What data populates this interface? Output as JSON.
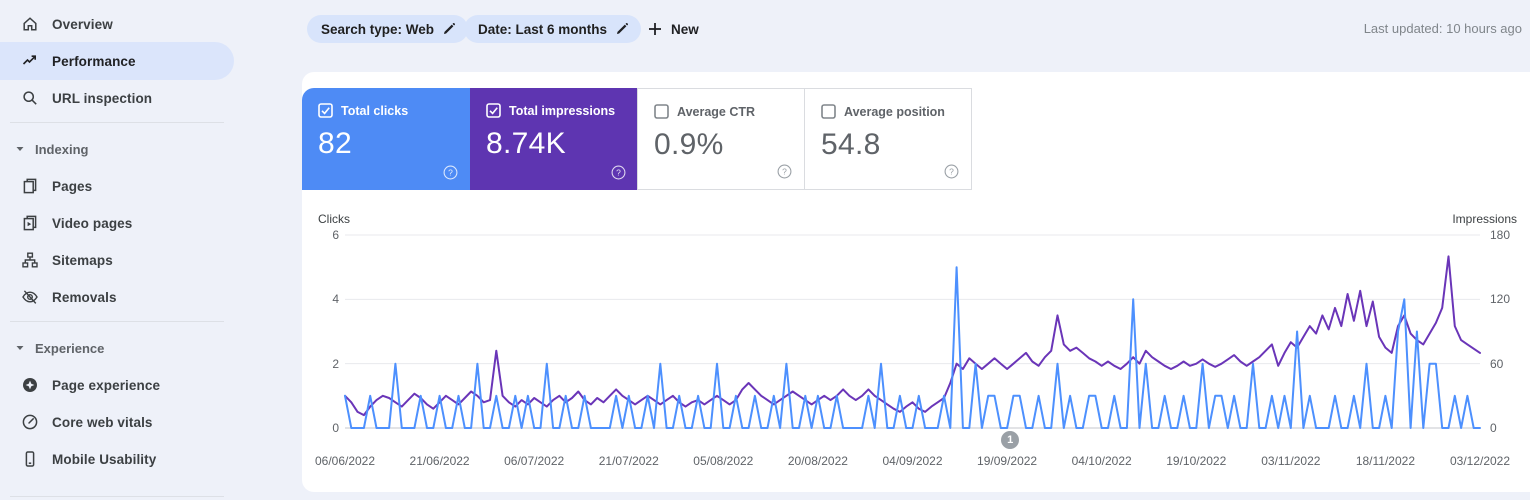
{
  "sidebar": {
    "items": [
      {
        "label": "Overview",
        "icon": "home-icon"
      },
      {
        "label": "Performance",
        "icon": "trending-up-icon",
        "selected": true
      },
      {
        "label": "URL inspection",
        "icon": "search-icon"
      }
    ],
    "sections": [
      {
        "label": "Indexing",
        "items": [
          {
            "label": "Pages",
            "icon": "pages-icon"
          },
          {
            "label": "Video pages",
            "icon": "video-pages-icon"
          },
          {
            "label": "Sitemaps",
            "icon": "sitemap-icon"
          },
          {
            "label": "Removals",
            "icon": "eye-off-icon"
          }
        ]
      },
      {
        "label": "Experience",
        "items": [
          {
            "label": "Page experience",
            "icon": "page-experience-icon"
          },
          {
            "label": "Core web vitals",
            "icon": "speedometer-icon"
          },
          {
            "label": "Mobile Usability",
            "icon": "mobile-icon"
          }
        ]
      }
    ]
  },
  "topbar": {
    "search_type_chip": "Search type: Web",
    "date_chip": "Date: Last 6 months",
    "new_label": "New",
    "last_updated": "Last updated: 10 hours ago"
  },
  "cards": [
    {
      "label": "Total clicks",
      "value": "82",
      "checked": true,
      "color": "#4e8bf5"
    },
    {
      "label": "Total impressions",
      "value": "8.74K",
      "checked": true,
      "color": "#5e35b1"
    },
    {
      "label": "Average CTR",
      "value": "0.9%",
      "checked": false
    },
    {
      "label": "Average position",
      "value": "54.8",
      "checked": false
    }
  ],
  "chart_data": {
    "type": "line",
    "x_start": "06/06/2022",
    "x_end": "03/12/2022",
    "x_tick_labels": [
      "06/06/2022",
      "21/06/2022",
      "06/07/2022",
      "21/07/2022",
      "05/08/2022",
      "20/08/2022",
      "04/09/2022",
      "19/09/2022",
      "04/10/2022",
      "19/10/2022",
      "03/11/2022",
      "18/11/2022",
      "03/12/2022"
    ],
    "y_left": {
      "label": "Clicks",
      "ticks": [
        6,
        4,
        2,
        0
      ],
      "max": 6
    },
    "y_right": {
      "label": "Impressions",
      "ticks": [
        180,
        120,
        60,
        0
      ],
      "max": 180
    },
    "grid": true,
    "legend_position": "none",
    "annotation": {
      "label": "1",
      "day_index": 105.5
    },
    "series": [
      {
        "name": "Total clicks",
        "axis": "left",
        "color": "#4d90fe",
        "values": [
          1,
          0,
          0,
          0,
          1,
          0,
          0,
          0,
          2,
          0,
          0,
          0,
          1,
          0,
          0,
          1,
          0,
          0,
          1,
          0,
          0,
          2,
          0,
          0,
          1,
          0,
          0,
          1,
          0,
          1,
          0,
          0,
          2,
          0,
          0,
          1,
          0,
          0,
          1,
          0,
          0,
          0,
          0,
          1,
          0,
          1,
          0,
          0,
          1,
          0,
          2,
          0,
          0,
          1,
          0,
          0,
          1,
          0,
          0,
          2,
          0,
          0,
          1,
          0,
          0,
          1,
          0,
          0,
          1,
          0,
          2,
          0,
          0,
          1,
          0,
          1,
          0,
          0,
          1,
          0,
          0,
          0,
          0,
          1,
          0,
          2,
          0,
          0,
          1,
          0,
          0,
          1,
          0,
          0,
          0,
          1,
          0,
          5,
          0,
          0,
          2,
          0,
          1,
          1,
          0,
          0,
          1,
          1,
          0,
          0,
          1,
          0,
          0,
          2,
          0,
          1,
          0,
          0,
          1,
          1,
          0,
          0,
          1,
          0,
          0,
          4,
          0,
          2,
          0,
          0,
          1,
          0,
          0,
          1,
          0,
          0,
          2,
          0,
          1,
          1,
          0,
          1,
          0,
          0,
          2,
          0,
          0,
          1,
          0,
          1,
          0,
          3,
          0,
          1,
          0,
          0,
          0,
          1,
          0,
          0,
          1,
          0,
          2,
          0,
          0,
          1,
          0,
          3,
          4,
          0,
          3,
          0,
          2,
          2,
          0,
          0,
          1,
          0,
          1,
          0,
          0
        ]
      },
      {
        "name": "Total impressions",
        "axis": "right",
        "color": "#6a35b8",
        "values": [
          30,
          24,
          15,
          12,
          20,
          26,
          30,
          28,
          24,
          20,
          26,
          32,
          28,
          22,
          18,
          24,
          30,
          26,
          22,
          28,
          34,
          30,
          24,
          26,
          72,
          30,
          24,
          20,
          26,
          22,
          28,
          24,
          20,
          26,
          30,
          24,
          28,
          34,
          26,
          22,
          28,
          24,
          30,
          36,
          30,
          26,
          22,
          26,
          30,
          26,
          22,
          26,
          30,
          24,
          20,
          24,
          26,
          22,
          26,
          30,
          26,
          22,
          26,
          36,
          42,
          36,
          30,
          26,
          22,
          26,
          30,
          34,
          30,
          26,
          22,
          26,
          30,
          26,
          30,
          36,
          30,
          26,
          30,
          36,
          30,
          26,
          22,
          18,
          15,
          20,
          24,
          18,
          15,
          20,
          24,
          28,
          42,
          60,
          55,
          65,
          60,
          55,
          60,
          65,
          60,
          55,
          60,
          65,
          70,
          62,
          58,
          66,
          72,
          105,
          78,
          72,
          75,
          70,
          65,
          62,
          58,
          62,
          58,
          55,
          60,
          66,
          60,
          72,
          66,
          62,
          58,
          55,
          58,
          62,
          58,
          60,
          64,
          60,
          57,
          60,
          64,
          68,
          62,
          58,
          62,
          66,
          72,
          78,
          58,
          70,
          80,
          75,
          85,
          95,
          88,
          105,
          92,
          112,
          95,
          125,
          100,
          128,
          95,
          118,
          85,
          75,
          70,
          95,
          105,
          88,
          82,
          78,
          88,
          98,
          112,
          160,
          95,
          82,
          78,
          74,
          70
        ]
      }
    ]
  }
}
